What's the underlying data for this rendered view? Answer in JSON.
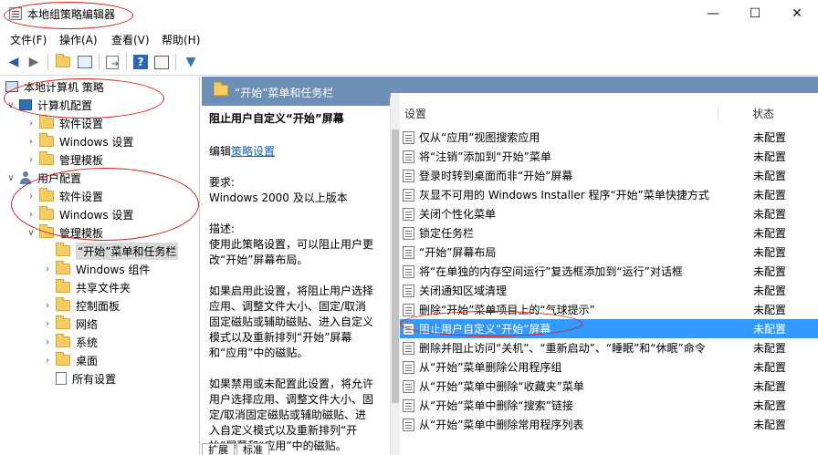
{
  "window": {
    "title": "本地组策略编辑器",
    "controls": {
      "minimize": "—",
      "maximize": "☐",
      "close": "✕"
    }
  },
  "menu": [
    "文件(F)",
    "操作(A)",
    "查看(V)",
    "帮助(H)"
  ],
  "toolbar": [
    "back-arrow",
    "forward-arrow",
    "up-folder",
    "show-hide-tree",
    "export-list",
    "help",
    "properties",
    "filter"
  ],
  "tree": {
    "root": "本地计算机 策略",
    "computer": {
      "label": "计算机配置",
      "children": [
        "软件设置",
        "Windows 设置",
        "管理模板"
      ]
    },
    "user": {
      "label": "用户配置",
      "children": [
        "软件设置",
        "Windows 设置",
        "管理模板"
      ],
      "admin_templates": [
        "“开始”菜单和任务栏",
        "Windows 组件",
        "共享文件夹",
        "控制面板",
        "网络",
        "系统",
        "桌面",
        "所有设置"
      ]
    }
  },
  "detail": {
    "header": "“开始”菜单和任务栏",
    "policy_title": "阻止用户自定义“开始”屏幕",
    "edit_prefix": "编辑",
    "edit_link": "策略设置",
    "req_label": "要求:",
    "req_value": "Windows 2000 及以上版本",
    "desc_label": "描述:",
    "desc_text": "使用此策略设置，可以阻止用户更改“开始”屏幕布局。",
    "enabled_text": "如果启用此设置，将阻止用户选择应用、调整文件大小、固定/取消固定磁贴或辅助磁贴、进入自定义模式以及重新排列“开始”屏幕和“应用”中的磁贴。",
    "disabled_text": "如果禁用或未配置此设置，将允许用户选择应用、调整文件大小、固定/取消固定磁贴或辅助磁贴、进入自定义模式以及重新排列“开始”屏幕和“应用”中的磁贴。"
  },
  "list": {
    "col_setting": "设置",
    "col_state": "状态",
    "rows": [
      {
        "label": "仅从“应用”视图搜索应用",
        "state": "未配置"
      },
      {
        "label": "将“注销”添加到“开始”菜单",
        "state": "未配置"
      },
      {
        "label": "登录时转到桌面而非“开始”屏幕",
        "state": "未配置"
      },
      {
        "label": "灰显不可用的 Windows Installer 程序“开始”菜单快捷方式",
        "state": "未配置"
      },
      {
        "label": "关闭个性化菜单",
        "state": "未配置"
      },
      {
        "label": "锁定任务栏",
        "state": "未配置"
      },
      {
        "label": "“开始”屏幕布局",
        "state": "未配置"
      },
      {
        "label": "将“在单独的内存空间运行”复选框添加到“运行”对话框",
        "state": "未配置"
      },
      {
        "label": "关闭通知区域清理",
        "state": "未配置"
      },
      {
        "label": "删除“开始”菜单项目上的“气球提示”",
        "state": "未配置"
      },
      {
        "label": "阻止用户自定义“开始”屏幕",
        "state": "未配置"
      },
      {
        "label": "删除并阻止访问“关机”、“重新启动”、“睡眠”和“休眠”命令",
        "state": "未配置"
      },
      {
        "label": "从“开始”菜单删除公用程序组",
        "state": "未配置"
      },
      {
        "label": "从“开始”菜单中删除“收藏夹”菜单",
        "state": "未配置"
      },
      {
        "label": "从“开始”菜单中删除“搜索”链接",
        "state": "未配置"
      },
      {
        "label": "从“开始”菜单中删除常用程序列表",
        "state": "未配置"
      }
    ]
  },
  "tabs": [
    "扩展",
    "标准"
  ],
  "colors": {
    "selection": "#3399ff",
    "header_band": "#6d8fb5",
    "annotation": "#d91d1d"
  }
}
